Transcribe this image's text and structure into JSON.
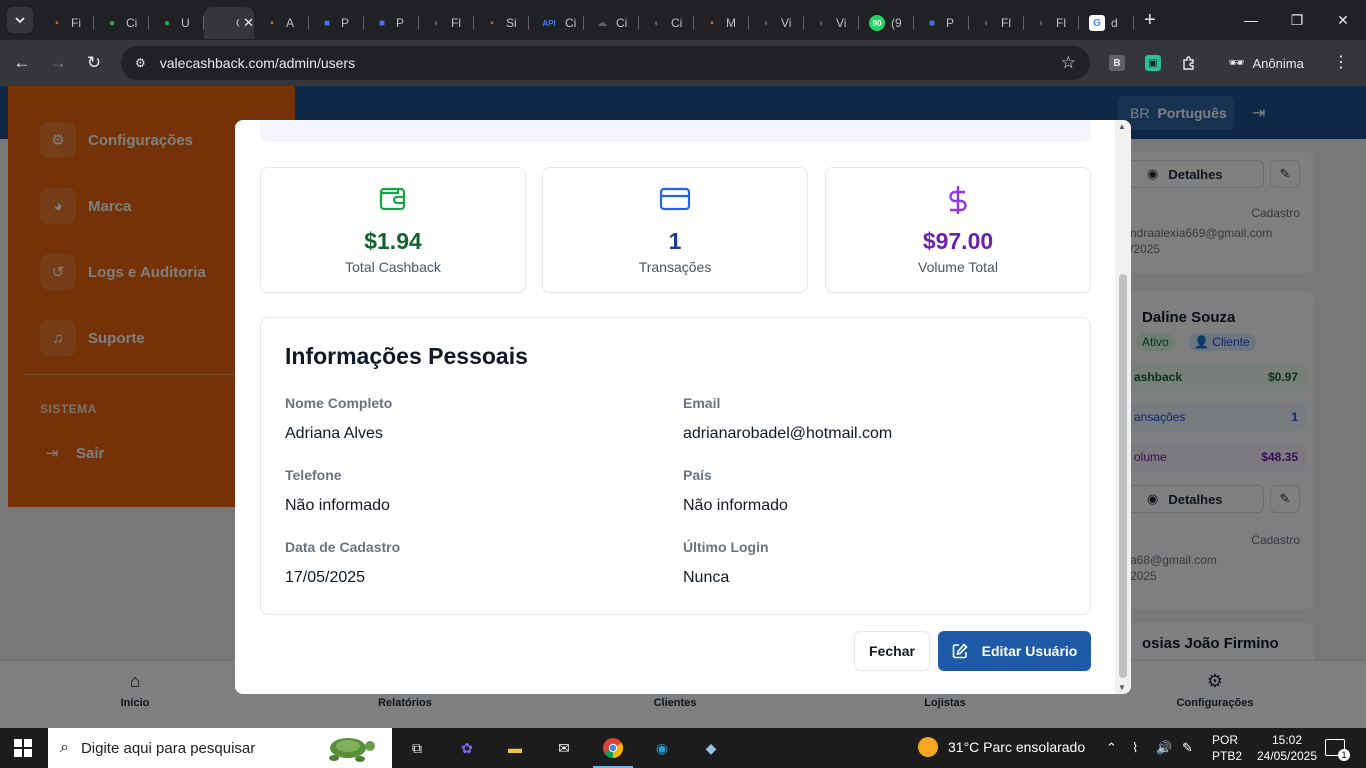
{
  "browser": {
    "tabs": [
      {
        "title": "Fi",
        "color": "#e8590c",
        "glyph": "▪"
      },
      {
        "title": "Ci",
        "color": "#34a853",
        "glyph": "●"
      },
      {
        "title": "U",
        "color": "#34a853",
        "glyph": "●"
      },
      {
        "title": "G",
        "color": "#5f6368",
        "glyph": "",
        "active": true
      },
      {
        "title": "A",
        "color": "#e8590c",
        "glyph": "▪"
      },
      {
        "title": "P",
        "color": "#4f6bed",
        "glyph": "■"
      },
      {
        "title": "P",
        "color": "#4f6bed",
        "glyph": "■"
      },
      {
        "title": "Fl",
        "color": "#5f6368",
        "glyph": "◐"
      },
      {
        "title": "Si",
        "color": "#e8590c",
        "glyph": "▪"
      },
      {
        "title": "Ci",
        "color": "#3b82f6",
        "glyph": "API"
      },
      {
        "title": "Ci",
        "color": "#5f6368",
        "glyph": "☁"
      },
      {
        "title": "Ci",
        "color": "#5f6368",
        "glyph": "◐"
      },
      {
        "title": "M",
        "color": "#e8590c",
        "glyph": "▪"
      },
      {
        "title": "Vi",
        "color": "#5f6368",
        "glyph": "◐"
      },
      {
        "title": "Vi",
        "color": "#5f6368",
        "glyph": "◐"
      },
      {
        "title": "(9",
        "color": "#25d366",
        "glyph": "90"
      },
      {
        "title": "P",
        "color": "#4f6bed",
        "glyph": "■"
      },
      {
        "title": "Fl",
        "color": "#5f6368",
        "glyph": "◐"
      },
      {
        "title": "Fl",
        "color": "#5f6368",
        "glyph": "◐"
      },
      {
        "title": "d",
        "color": "#ffffff",
        "glyph": "G"
      }
    ],
    "url": "valecashback.com/admin/users",
    "profile_label": "Anônima",
    "extension_b": "B"
  },
  "app": {
    "language_flag": "BR",
    "language_label": "Português",
    "sidebar": {
      "items": [
        {
          "label": "Configurações",
          "icon": "⚙"
        },
        {
          "label": "Marca",
          "icon": "🎨"
        },
        {
          "label": "Logs e Auditoria",
          "icon": "↺"
        },
        {
          "label": "Suporte",
          "icon": "🎧"
        }
      ],
      "section_heading": "SISTEMA",
      "logout_label": "Sair"
    },
    "user_cards": {
      "details_label": "Detalhes",
      "registration_label": "Cadastro",
      "card1": {
        "email": "ndraalexia669@gmail.com",
        "date": "/2025"
      },
      "card2": {
        "name": "Daline Souza",
        "status": "Ativo",
        "role": "Cliente",
        "cashback_label": "ashback",
        "cashback_value": "$0.97",
        "transactions_label": "ansações",
        "transactions_value": "1",
        "volume_label": "olume",
        "volume_value": "$48.35",
        "email": "a68@gmail.com",
        "date": "2025"
      },
      "card3": {
        "name": "osias João Firmino"
      }
    },
    "bottom_nav": [
      "Início",
      "Relatórios",
      "Clientes",
      "Lojistas",
      "Configurações"
    ]
  },
  "modal": {
    "stats": [
      {
        "value": "$1.94",
        "label": "Total Cashback",
        "color": "#14632f",
        "icon": "wallet-icon"
      },
      {
        "value": "1",
        "label": "Transações",
        "color": "#1e3a8a",
        "icon": "credit-card-icon"
      },
      {
        "value": "$97.00",
        "label": "Volume Total",
        "color": "#6b21a8",
        "icon": "dollar-icon"
      }
    ],
    "info_title": "Informações Pessoais",
    "fields": {
      "full_name": {
        "label": "Nome Completo",
        "value": "Adriana Alves"
      },
      "email": {
        "label": "Email",
        "value": "adrianarobadel@hotmail.com"
      },
      "phone": {
        "label": "Telefone",
        "value": "Não informado"
      },
      "country": {
        "label": "País",
        "value": "Não informado"
      },
      "registration": {
        "label": "Data de Cadastro",
        "value": "17/05/2025"
      },
      "last_login": {
        "label": "Último Login",
        "value": "Nunca"
      }
    },
    "close_label": "Fechar",
    "edit_label": "Editar Usuário"
  },
  "taskbar": {
    "search_placeholder": "Digite aqui para pesquisar",
    "weather": "31°C  Parc ensolarado",
    "lang_line1": "POR",
    "lang_line2": "PTB2",
    "time": "15:02",
    "date": "24/05/2025",
    "notification_count": "1"
  }
}
